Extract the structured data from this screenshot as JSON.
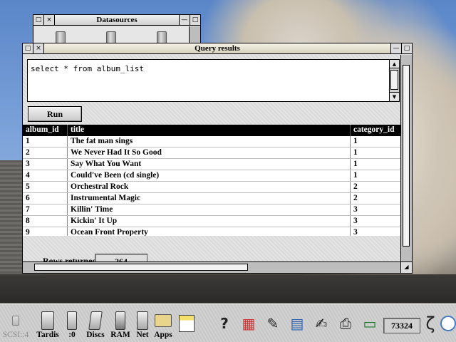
{
  "datasources_window": {
    "title": "Datasources",
    "close_glyph": "×",
    "back_glyph": "□",
    "iconize_glyph": "—",
    "toggle_glyph": "□"
  },
  "query_window": {
    "title": "Query results",
    "close_glyph": "×",
    "back_glyph": "□",
    "iconize_glyph": "—",
    "toggle_glyph": "□",
    "sql": "select * from album_list",
    "run_label": "Run",
    "columns": [
      "album_id",
      "title",
      "category_id"
    ],
    "rows": [
      [
        "1",
        "The fat man sings",
        "1"
      ],
      [
        "2",
        "We Never Had It So Good",
        "1"
      ],
      [
        "3",
        "Say What You Want",
        "1"
      ],
      [
        "4",
        "Could've Been (cd single)",
        "1"
      ],
      [
        "5",
        "Orchestral Rock",
        "2"
      ],
      [
        "6",
        "Instrumental Magic",
        "2"
      ],
      [
        "7",
        "Killin' Time",
        "3"
      ],
      [
        "8",
        "Kickin' It Up",
        "3"
      ],
      [
        "9",
        "Ocean Front Property",
        "3"
      ]
    ],
    "rows_returned_label": "Rows returned",
    "rows_returned_value": "264",
    "scroll_up_glyph": "▲",
    "scroll_down_glyph": "▼",
    "resize_glyph": "◢"
  },
  "iconbar": {
    "devices": [
      {
        "label": "SCSI::4",
        "icon": "scsi-drive-icon",
        "dim": true
      },
      {
        "label": "Tardis",
        "icon": "harddisc-icon"
      },
      {
        "label": ":0",
        "icon": "floppy-drive-icon"
      },
      {
        "label": "Discs",
        "icon": "discs-icon"
      },
      {
        "label": "RAM",
        "icon": "ramdisc-icon"
      },
      {
        "label": "Net",
        "icon": "network-icon"
      }
    ],
    "apps_label": "Apps",
    "clock": "73324",
    "task_glyphs": {
      "help": "?",
      "paint": "▦",
      "draw": "✎",
      "chart": "▤",
      "edit": "✍",
      "printer": "⎙",
      "terminal": "▭",
      "zeta": "ζ"
    }
  }
}
